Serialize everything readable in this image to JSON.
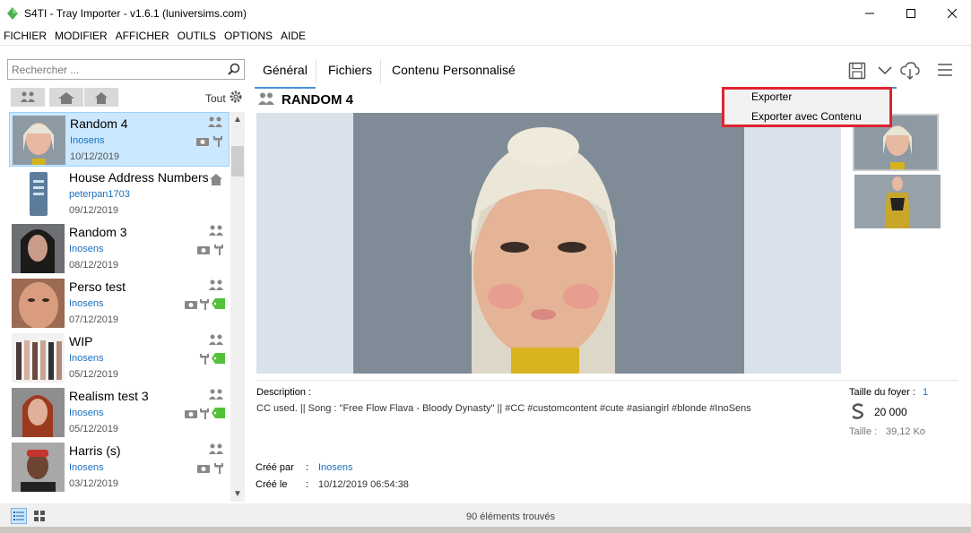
{
  "window": {
    "title": "S4TI - Tray Importer - v1.6.1  (luniversims.com)"
  },
  "menubar": [
    "FICHIER",
    "MODIFIER",
    "AFFICHER",
    "OUTILS",
    "OPTIONS",
    "AIDE"
  ],
  "search": {
    "placeholder": "Rechercher ..."
  },
  "filters": {
    "tout_label": "Tout"
  },
  "list": [
    {
      "name": "Random 4",
      "author": "Inosens",
      "date": "10/12/2019",
      "selected": true
    },
    {
      "name": "House Address Numbers",
      "author": "peterpan1703",
      "date": "09/12/2019"
    },
    {
      "name": "Random 3",
      "author": "Inosens",
      "date": "08/12/2019"
    },
    {
      "name": "Perso test",
      "author": "Inosens",
      "date": "07/12/2019"
    },
    {
      "name": "WIP",
      "author": "Inosens",
      "date": "05/12/2019"
    },
    {
      "name": "Realism test 3",
      "author": "Inosens",
      "date": "05/12/2019"
    },
    {
      "name": "Harris (s)",
      "author": "Inosens",
      "date": "03/12/2019"
    }
  ],
  "tabs": [
    "Général",
    "Fichiers",
    "Contenu Personnalisé"
  ],
  "dropdown": {
    "items": [
      "Exporter",
      "Exporter avec Contenu"
    ]
  },
  "detail": {
    "title": "RANDOM 4",
    "description_label": "Description :",
    "description": "CC used. || Song : \"Free Flow Flava - Bloody Dynasty\" || #CC #customcontent #cute #asiangirl #blonde #InoSens",
    "household_label": "Taille du foyer :",
    "household_value": "1",
    "money": "20 000",
    "size_label": "Taille :",
    "size_value": "39,12 Ko",
    "created_by_label": "Créé par",
    "created_by": "Inosens",
    "created_on_label": "Créé le",
    "created_on": "10/12/2019 06:54:38",
    "colon": ":"
  },
  "status": {
    "text": "90 éléments trouvés"
  },
  "colors": {
    "accent": "#4a90d9",
    "highlight_border": "#e0232e",
    "link": "#1a6fc0",
    "selection": "#cce8ff"
  }
}
